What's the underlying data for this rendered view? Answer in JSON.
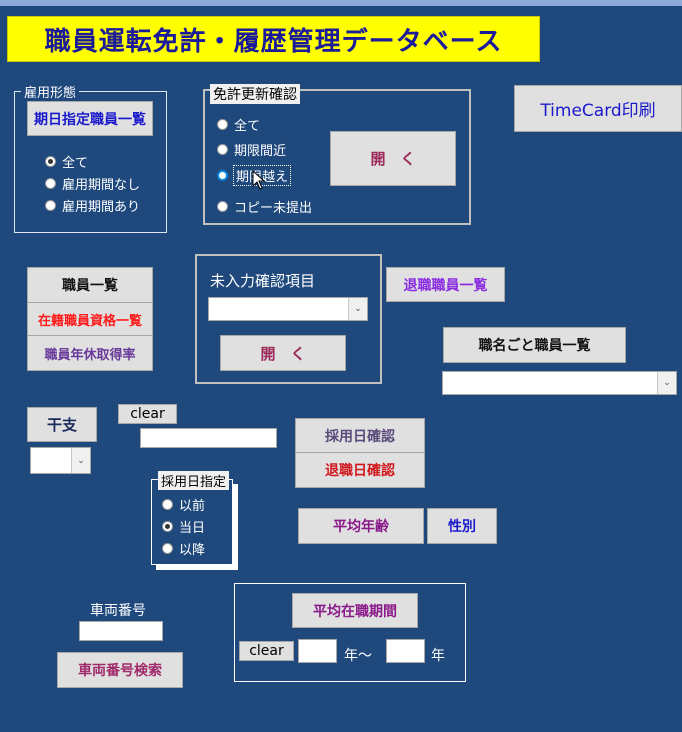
{
  "title": "職員運転免許・履歴管理データベース",
  "employment_type": {
    "legend": "雇用形態",
    "button": "期日指定職員一覧",
    "options": [
      "全て",
      "雇用期間なし",
      "雇用期間あり"
    ],
    "selected": "全て"
  },
  "license_renewal": {
    "legend": "免許更新確認",
    "options": [
      "全て",
      "期限間近",
      "期限越え",
      "コピー未提出"
    ],
    "selected": "期限越え",
    "open_button": "開　く"
  },
  "timecard_button": "TimeCard印刷",
  "staff_list": {
    "button_list": "職員一覧",
    "button_qualification": "在籍職員資格一覧",
    "button_leave_rate": "職員年休取得率"
  },
  "unentered_check": {
    "label": "未入力確認項目",
    "combo_value": "",
    "open_button": "開　く"
  },
  "retired_list_button": "退職職員一覧",
  "by_position": {
    "button": "職名ごと職員一覧",
    "combo_value": ""
  },
  "eto": {
    "button": "干支",
    "combo_value": ""
  },
  "clear_button": "clear",
  "search_input_value": "",
  "hire_date_check_button": "採用日確認",
  "retire_date_check_button": "退職日確認",
  "hire_date_spec": {
    "legend": "採用日指定",
    "options": [
      "以前",
      "当日",
      "以降"
    ],
    "selected": "当日"
  },
  "average_age_button": "平均年齢",
  "gender_button": "性別",
  "vehicle": {
    "label": "車両番号",
    "input_value": "",
    "search_button": "車両番号検索"
  },
  "tenure": {
    "button": "平均在職期間",
    "clear_button": "clear",
    "from_value": "",
    "from_unit": "年〜",
    "to_value": "",
    "to_unit": "年"
  },
  "colors": {
    "background": "#1f497d",
    "title_bg": "#ffff00",
    "title_text": "#1a1a9a"
  }
}
